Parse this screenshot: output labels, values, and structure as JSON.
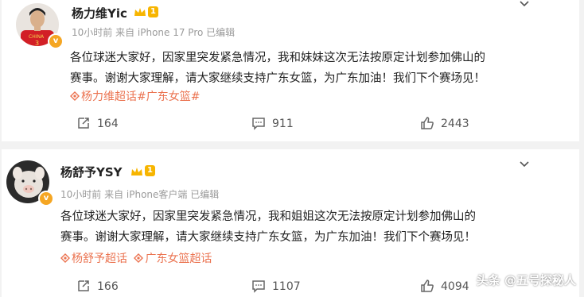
{
  "posts": [
    {
      "username": "杨力维Yic",
      "level": "1",
      "meta": "10小时前 来自 iPhone 17 Pro 已编辑",
      "body_line1": "各位球迷大家好，因家里突发紧急情况，我和妹妹这次无法按原定计划参加佛山的",
      "body_line2": "赛事。谢谢大家理解，请大家继续支持广东女篮，为广东加油！我们下个赛场见！",
      "tags": [
        "杨力维超话",
        "#广东女篮#"
      ],
      "reposts": "164",
      "comments": "911",
      "likes": "2443"
    },
    {
      "username": "杨舒予YSY",
      "level": "1",
      "meta": "10小时前 来自 iPhone客户端 已编辑",
      "body_line1": "各位球迷大家好，因家里突发紧急情况，我和姐姐这次无法按原定计划参加佛山的",
      "body_line2": "赛事。谢谢大家理解，请大家继续支持广东女篮，为广东加油！我们下个赛场见！",
      "tags": [
        "杨舒予超话",
        "广东女篮超话"
      ],
      "reposts": "166",
      "comments": "1107",
      "likes": "4094"
    }
  ],
  "watermark": "头条 @五号探秘人",
  "colors": {
    "tag": "#eb7350",
    "badge": "#f5a623",
    "meta": "#9a9a9a"
  },
  "icons": [
    "chevron-down-icon",
    "repost-icon",
    "comment-icon",
    "like-icon",
    "supertopic-icon",
    "crown-icon",
    "verified-badge-icon"
  ]
}
